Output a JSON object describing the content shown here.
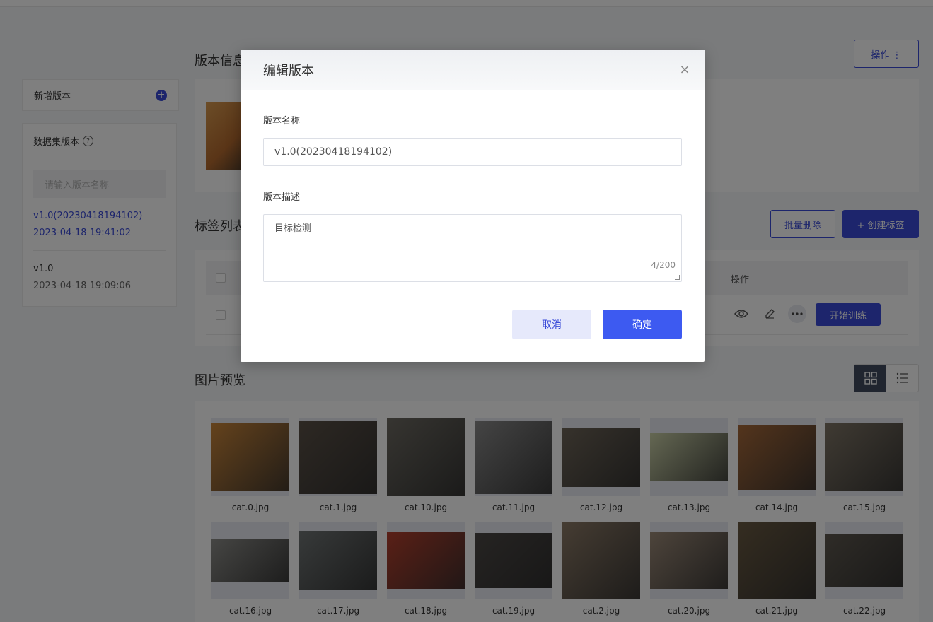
{
  "sidebar": {
    "add_version_label": "新增版本",
    "versions_title": "数据集版本",
    "help_glyph": "?",
    "search_placeholder": "请输入版本名称",
    "versions": [
      {
        "name": "v1.0(20230418194102)",
        "date": "2023-04-18 19:41:02",
        "active": true
      },
      {
        "name": "v1.0",
        "date": "2023-04-18 19:09:06",
        "active": false
      }
    ]
  },
  "main": {
    "version_info_title": "版本信息",
    "ops_button": "操作 ⋮",
    "labels_title": "标签列表",
    "batch_delete": "批量删除",
    "create_label": "+ 创建标签",
    "table_ops_header": "操作",
    "start_training": "开始训练",
    "preview_title": "图片预览",
    "images": [
      {
        "name": "cat.0.jpg",
        "color": "#c9853a"
      },
      {
        "name": "cat.1.jpg",
        "color": "#5b5147"
      },
      {
        "name": "cat.10.jpg",
        "color": "#6d6a62"
      },
      {
        "name": "cat.11.jpg",
        "color": "#8a8a8a"
      },
      {
        "name": "cat.12.jpg",
        "color": "#6e6558"
      },
      {
        "name": "cat.13.jpg",
        "color": "#c9cfa6"
      },
      {
        "name": "cat.14.jpg",
        "color": "#a86a3a"
      },
      {
        "name": "cat.15.jpg",
        "color": "#7f7566"
      },
      {
        "name": "cat.16.jpg",
        "color": "#8c8c88"
      },
      {
        "name": "cat.17.jpg",
        "color": "#6f7474"
      },
      {
        "name": "cat.18.jpg",
        "color": "#b5402e"
      },
      {
        "name": "cat.19.jpg",
        "color": "#4c4845"
      },
      {
        "name": "cat.2.jpg",
        "color": "#8c7a66"
      },
      {
        "name": "cat.20.jpg",
        "color": "#9c8a78"
      },
      {
        "name": "cat.21.jpg",
        "color": "#6a5a42"
      },
      {
        "name": "cat.22.jpg",
        "color": "#5e584f"
      }
    ]
  },
  "modal": {
    "title": "编辑版本",
    "close_glyph": "×",
    "name_label": "版本名称",
    "name_value": "v1.0(20230418194102)",
    "desc_label": "版本描述",
    "desc_value": "目标检测",
    "desc_counter": "4/200",
    "cancel": "取消",
    "confirm": "确定"
  },
  "colors": {
    "primary": "#3a4ad8",
    "confirm": "#3d5af1"
  }
}
